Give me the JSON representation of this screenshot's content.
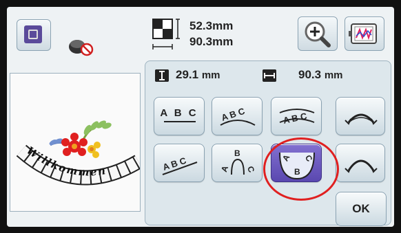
{
  "header": {
    "height_value": "52.3",
    "width_value": "90.3",
    "unit": "mm",
    "zoom_icon": "magnifier-plus-icon",
    "preview_icon": "embroidery-frame-preview-icon",
    "frame_icon": "hoop-frame-icon",
    "thread_icon": "thread-spool-no-icon"
  },
  "preview": {
    "text": "Willkommen",
    "decoration": "flowers-and-leaves-embroidery"
  },
  "panel": {
    "height_measure": "29.1",
    "width_measure": "90.3",
    "unit": "mm",
    "height_icon": "vertical-size-icon",
    "width_icon": "horizontal-size-icon"
  },
  "arrangement_buttons": [
    {
      "name": "straight-line",
      "label": "ABC",
      "selected": false
    },
    {
      "name": "arc-up",
      "label": "ABC",
      "selected": false
    },
    {
      "name": "arc-down",
      "label": "ABC",
      "selected": false
    },
    {
      "name": "slant",
      "label": "ABC",
      "selected": false
    },
    {
      "name": "circle-outer",
      "label": "ABC",
      "selected": false
    },
    {
      "name": "circle-inner",
      "label": "ABC",
      "selected": true
    }
  ],
  "curve_buttons": [
    {
      "name": "increase-curve",
      "icon": "arc-arrows-icon"
    },
    {
      "name": "decrease-curve",
      "icon": "arc-arrows-icon"
    }
  ],
  "ok_label": "OK",
  "colors": {
    "selected": "#6e5cc2",
    "highlight_circle": "#e02020",
    "button_border": "#8aa2b2"
  }
}
